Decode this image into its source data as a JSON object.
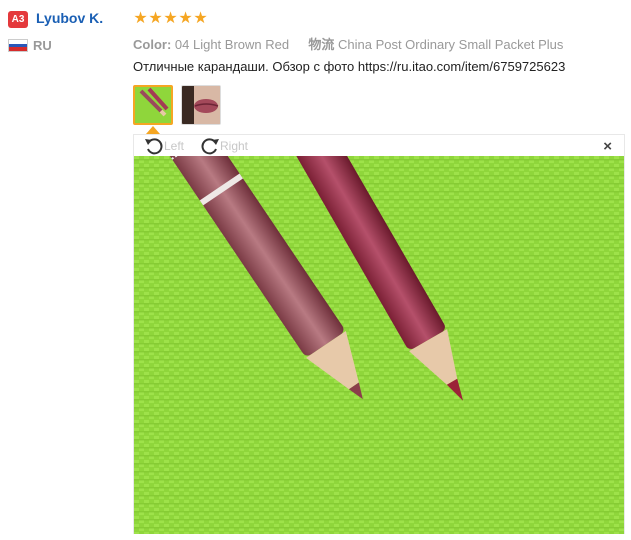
{
  "reviewer": {
    "badge": "A3",
    "name": "Lyubov K.",
    "country_code": "RU"
  },
  "rating": {
    "stars": 5,
    "max": 5,
    "color": "#f5a623"
  },
  "attributes": {
    "color_label": "Color:",
    "color_value": "04 Light Brown Red",
    "logistics_label": "物流",
    "logistics_value": "China Post Ordinary Small Packet Plus"
  },
  "review_text": "Отличные карандаши. Обзор с фото https://ru.itao.com/item/6759725623",
  "thumbnails": [
    "pencils-on-green-photo",
    "lips-photo"
  ],
  "viewer": {
    "rotate_left_label": "Left",
    "rotate_right_label": "Right",
    "close_label": "×"
  },
  "colors": {
    "name_link": "#1a5fb4",
    "badge": "#e4393c",
    "background_green": "#8fd63b"
  }
}
